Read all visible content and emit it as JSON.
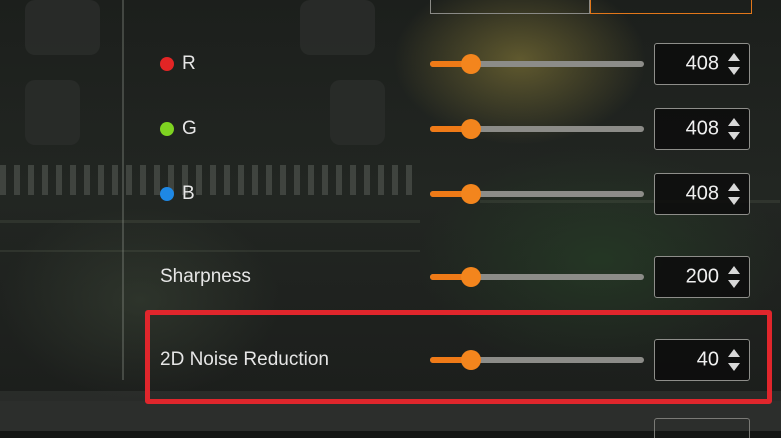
{
  "colors": {
    "accent": "#ef7a17",
    "highlight": "#e0262c",
    "red_dot": "#e32525",
    "green_dot": "#7ed321",
    "blue_dot": "#1e88e5"
  },
  "rows": [
    {
      "key": "r",
      "label": "R",
      "dot": "red",
      "value": "408",
      "slider_fraction": 0.19
    },
    {
      "key": "g",
      "label": "G",
      "dot": "green",
      "value": "408",
      "slider_fraction": 0.19
    },
    {
      "key": "b",
      "label": "B",
      "dot": "blue",
      "value": "408",
      "slider_fraction": 0.19
    },
    {
      "key": "sharpness",
      "label": "Sharpness",
      "value": "200",
      "slider_fraction": 0.19
    },
    {
      "key": "noise",
      "label": "2D Noise Reduction",
      "value": "40",
      "slider_fraction": 0.19
    }
  ]
}
